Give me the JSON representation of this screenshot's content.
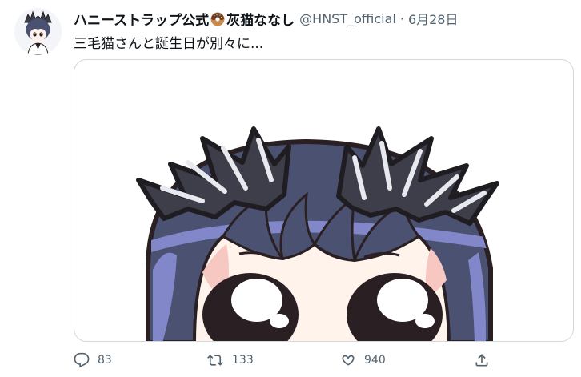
{
  "tweet": {
    "display_name": "ハニーストラップ公式",
    "display_name_suffix": "灰猫ななし",
    "name_emoji_icon": "donut-icon",
    "handle": "@HNST_official",
    "separator": "·",
    "date": "6月28日",
    "text": "三毛猫さんと誕生日が別々に..."
  },
  "actions": {
    "reply": {
      "icon": "reply-icon",
      "count": "83"
    },
    "retweet": {
      "icon": "retweet-icon",
      "count": "133"
    },
    "like": {
      "icon": "heart-icon",
      "count": "940"
    },
    "share": {
      "icon": "share-icon"
    }
  },
  "colors": {
    "text_primary": "#0f1419",
    "text_secondary": "#536471",
    "border": "#cfd9de",
    "hair": "#4a5171",
    "hair_highlight": "#7b80c4",
    "skin": "#fff1ea",
    "outline": "#2a1f22"
  }
}
